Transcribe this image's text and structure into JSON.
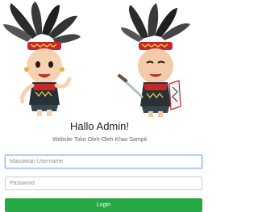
{
  "header": {
    "title": "Hallo Admin!",
    "subtitle": "Website Toko Oleh-Oleh Khas Sampit"
  },
  "form": {
    "username_placeholder": "Masukkan Username",
    "password_placeholder": "Password",
    "login_label": "Login"
  },
  "colors": {
    "login_button": "#28a745",
    "input_border": "#c9ced4",
    "focus_border": "#8ab6f0"
  },
  "images": {
    "mascots": "two Dayak mascot characters with feathered headdresses"
  }
}
